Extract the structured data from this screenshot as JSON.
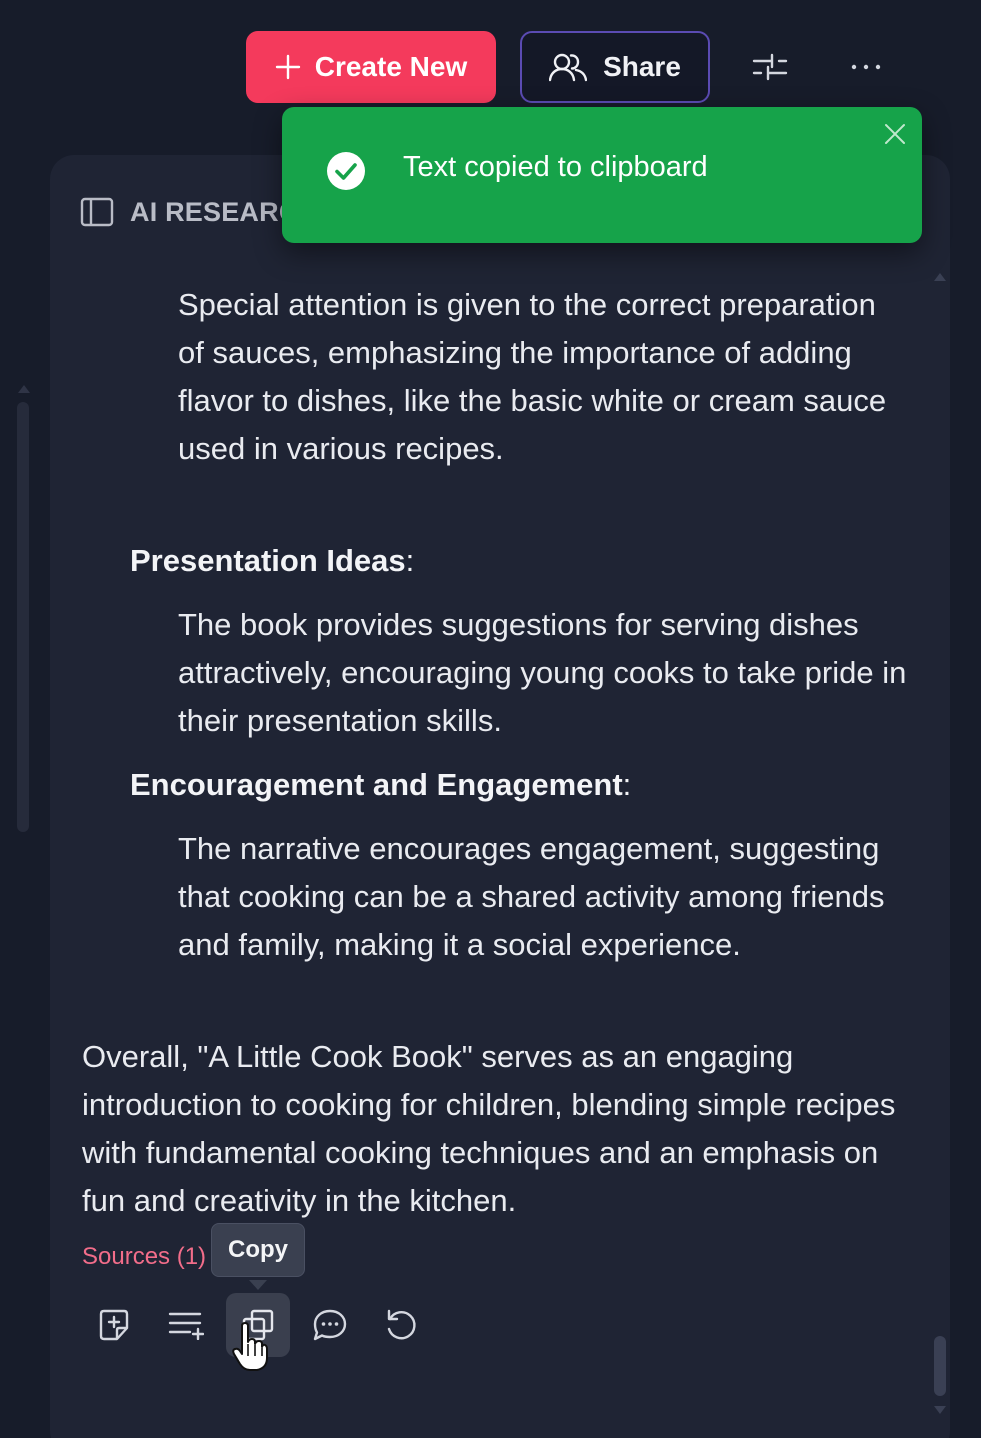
{
  "toolbar": {
    "create_label": "Create New",
    "share_label": "Share",
    "accent_color": "#f43a5c"
  },
  "panel": {
    "title": "AI RESEARC"
  },
  "toast": {
    "message": "Text copied to clipboard",
    "color": "#16a34a"
  },
  "content": {
    "p1": "Special attention is given to the correct preparation of sauces, emphasizing the importance of adding flavor to dishes, like the basic white or cream sauce used in various recipes.",
    "h1": "Presentation Ideas",
    "p2": "The book provides suggestions for serving dishes attractively, encouraging young cooks to take pride in their presentation skills.",
    "h2": "Encouragement and Engagement",
    "p3": "The narrative encourages engagement, suggesting that cooking can be a shared activity among friends and family, making it a social experience.",
    "p4": "Overall, \"A Little Cook Book\" serves as an engaging introduction to cooking for children, blending simple recipes with fundamental cooking techniques and an emphasis on fun and creativity in the kitchen.",
    "colon": ":"
  },
  "sources": {
    "label": "Sources (1)"
  },
  "tooltip": {
    "label": "Copy"
  },
  "actions": [
    {
      "icon": "add-note-icon"
    },
    {
      "icon": "add-to-list-icon"
    },
    {
      "icon": "copy-icon"
    },
    {
      "icon": "chat-icon"
    },
    {
      "icon": "regenerate-icon"
    }
  ]
}
